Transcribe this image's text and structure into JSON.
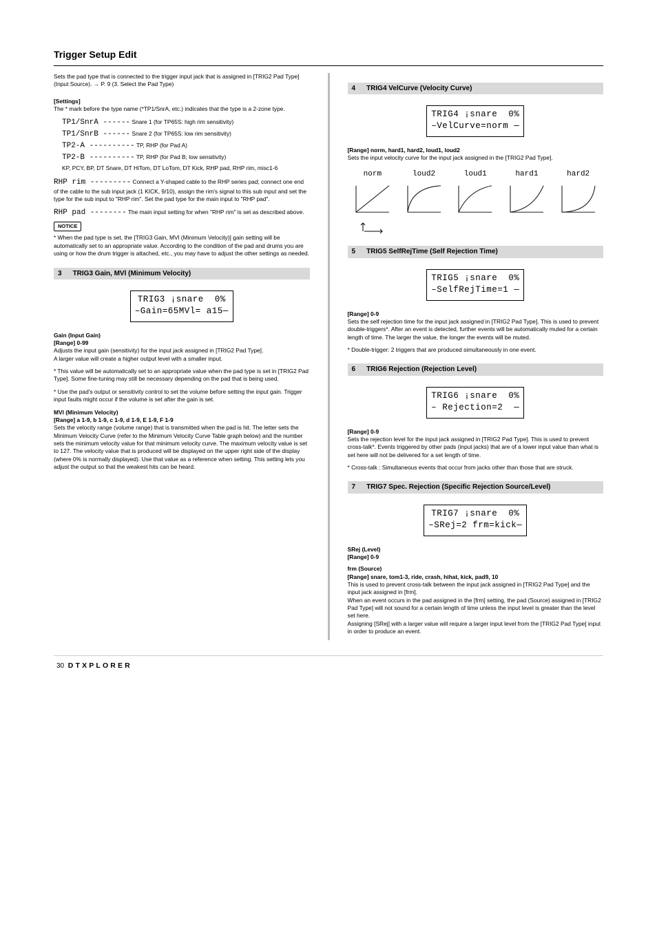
{
  "page_title": "Trigger Setup Edit",
  "left": {
    "intro1": "Sets the pad type that is connected to the trigger input jack that is assigned in [TRIG2 Pad Type] (Input Source). → P. 9 (3. Select the Pad Type)",
    "settings_label": "[Settings]",
    "settings_body": "The * mark before the type name (*TP1/SnrA, etc.) indicates that the type is a 2-zone type.",
    "sn_padA_lbl": "TP1/SnrA ------",
    "sn_padA_desc": "Snare 1 (for TP65S: high rim sensitivity)",
    "sn_padB_lbl": "TP1/SnrB ------",
    "sn_padB_desc": "Snare 2 (for TP65S: low rim sensitivity)",
    "tp2a_lbl": "TP2-A ----------",
    "tp2a_desc": "TP, RHP (for Pad A)",
    "tp2b_lbl": "TP2-B ----------",
    "tp2b_desc": "TP, RHP (for Pad B; low sensitivity)",
    "settings_tail": "KP, PCY, BP, DT Snare, DT HiTom, DT LoTom, DT Kick, RHP pad, RHP rim, misc1-6",
    "rhp_rim_lbl": "RHP rim ---------",
    "rhp_rim_desc": "Connect a Y-shaped cable to the RHP series pad; connect one end of the cable to the sub input jack (1 KICK, 9/10), assign the rim's signal to this sub input and set the type for the sub input to \"RHP rim\". Set the pad type for the main input to \"RHP pad\".",
    "rhp_pad_lbl": "RHP pad --------",
    "rhp_pad_desc": "The main input setting for when \"RHP rim\" is set as described above.",
    "notice_label": "NOTICE",
    "notice_body": "* When the pad type is set, the [TRIG3 Gain, MVl (Minimum Velocity)] gain setting will be automatically set to an appropriate value. According to the condition of the pad and drums you are using or how the drum trigger is attached, etc., you may have to adjust the other settings as needed.",
    "s3_num": "3",
    "s3_title": "TRIG3 Gain, MVl (Minimum Velocity)",
    "lcd3": "TRIG3 ¡snare  0%\n–Gain=65MVl= a15—",
    "gain_label": "Gain (Input Gain)",
    "gain_range": "[Range] 0-99",
    "gain_body": "Adjusts the input gain (sensitivity) for the input jack assigned in [TRIG2 Pad Type].\nA larger value will create a higher output level with a smaller input.",
    "gain_star1": "* This value will be automatically set to an appropriate value when the pad type is set in [TRIG2 Pad Type]. Some fine-tuning may still be necessary depending on the pad that is being used.",
    "gain_star2": "* Use the pad's output or sensitivity control to set the volume before setting the input gain. Trigger input faults might occur if the volume is set after the gain is set.",
    "mvl_label": "MVl (Minimum Velocity)",
    "mvl_range": "[Range] a 1-9, b 1-9, c 1-9, d 1-9, E 1-9, F 1-9",
    "mvl_body": "Sets the velocity range (volume range) that is transmitted when the pad is hit. The letter sets the Minimum Velocity Curve (refer to the Minimum Velocity Curve Table graph below) and the number sets the minimum velocity value for that minimum velocity curve. The maximum velocity value is set to 127. The velocity value that is produced will be displayed on the upper right side of the display (where 0% is normally displayed). Use that value as a reference when setting. This setting lets you adjust the output so that the weakest hits can be heard."
  },
  "right": {
    "s4_num": "4",
    "s4_title": "TRIG4 VelCurve (Velocity Curve)",
    "lcd4": "TRIG4 ¡snare  0%\n–VelCurve=norm —",
    "s4_range": "[Range] norm, hard1, hard2, loud1, loud2",
    "s4_body": "Sets the input velocity curve for the input jack assigned in the [TRIG2 Pad Type].",
    "curveLabels": [
      "norm",
      "loud2",
      "loud1",
      "hard1",
      "hard2"
    ],
    "s5_num": "5",
    "s5_title": "TRIG5 SelfRejTime (Self Rejection Time)",
    "lcd5": "TRIG5 ¡snare  0%\n–SelfRejTime=1 —",
    "s5_range": "[Range] 0-9",
    "s5_body": "Sets the self rejection time for the input jack assigned in [TRIG2 Pad Type]. This is used to prevent double-triggers*. After an event is detected, further events will be automatically muted for a certain length of time. The larger the value, the longer the events will be muted.",
    "s5_foot": "* Double-trigger: 2 triggers that are produced simultaneously in one event.",
    "s6_num": "6",
    "s6_title": "TRIG6 Rejection (Rejection Level)",
    "lcd6": "TRIG6 ¡snare  0%\n– Rejection=2  —",
    "s6_range": "[Range] 0-9",
    "s6_body": "Sets the rejection level for the input jack assigned in [TRIG2 Pad Type]. This is used to prevent cross-talk*. Events triggered by other pads (input jacks) that are of a lower input value than what is set here will not be delivered for a set length of time.",
    "s6_foot": "* Cross-talk : Simultaneous events that occur from jacks other than those that are struck.",
    "s7_num": "7",
    "s7_title": "TRIG7 Spec. Rejection (Specific Rejection Source/Level)",
    "lcd7": "TRIG7 ¡snare  0%\n–SRej=2 frm=kick—",
    "srej_label": "SRej (Level)",
    "srej_range": "[Range] 0-9",
    "frm_label": "frm (Source)",
    "frm_range": "[Range] snare, tom1-3, ride, crash, hihat, kick, pad9, 10",
    "s7_body": "This is used to prevent cross-talk between the input jack assigned in [TRIG2 Pad Type] and the input jack assigned in [frm].\nWhen an event occurs in the pad assigned in the [frm] setting, the pad (Source) assigned in [TRIG2 Pad Type] will not sound for a certain length of time unless the input level is greater than the level set here.\nAssigning [SRej] with a larger value will require a larger input level from the [TRIG2 Pad Type] input in order to produce an event."
  },
  "footer": {
    "page_num": "30",
    "brand": "DTXPLORER"
  }
}
